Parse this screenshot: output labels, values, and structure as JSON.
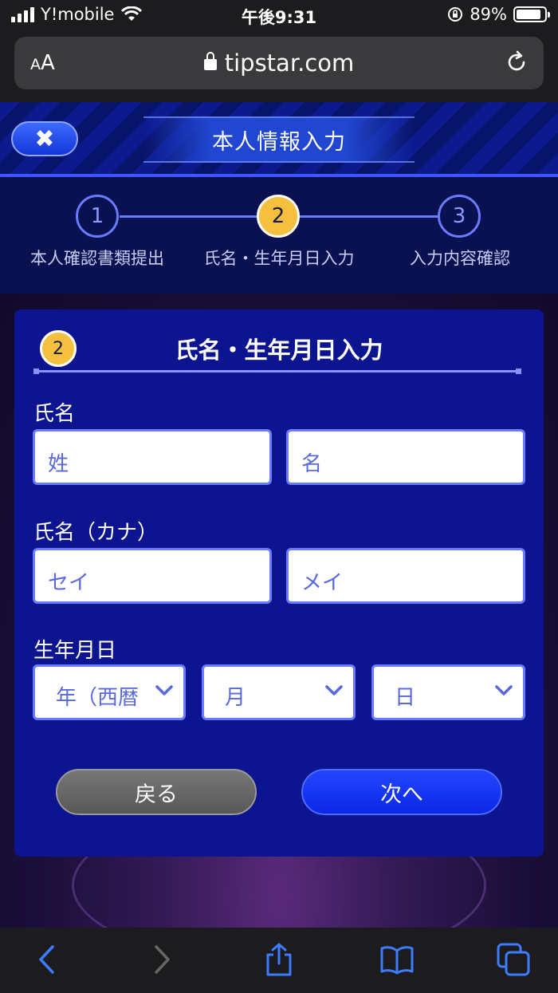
{
  "status_bar": {
    "carrier": "Y!mobile",
    "time": "午後9:31",
    "battery": "89%",
    "battery_level": 0.89
  },
  "browser": {
    "text_size_label": "AA",
    "url": "tipstar.com"
  },
  "header": {
    "close_label": "✖",
    "title": "本人情報入力"
  },
  "steps": [
    {
      "number": "1",
      "label": "本人確認書類提出"
    },
    {
      "number": "2",
      "label": "氏名・生年月日入力"
    },
    {
      "number": "3",
      "label": "入力内容確認"
    }
  ],
  "form": {
    "step_badge": "2",
    "title": "氏名・生年月日入力",
    "name_label": "氏名",
    "last_name_placeholder": "姓",
    "first_name_placeholder": "名",
    "kana_label": "氏名（カナ）",
    "last_kana_placeholder": "セイ",
    "first_kana_placeholder": "メイ",
    "birth_label": "生年月日",
    "year_select": "年（西暦",
    "month_select": "月",
    "day_select": "日",
    "back_button": "戻る",
    "next_button": "次へ"
  },
  "colors": {
    "accent": "#f5c040",
    "panel": "#0c1490",
    "primary_button": "#0a28e6",
    "border": "#6a7bff"
  }
}
